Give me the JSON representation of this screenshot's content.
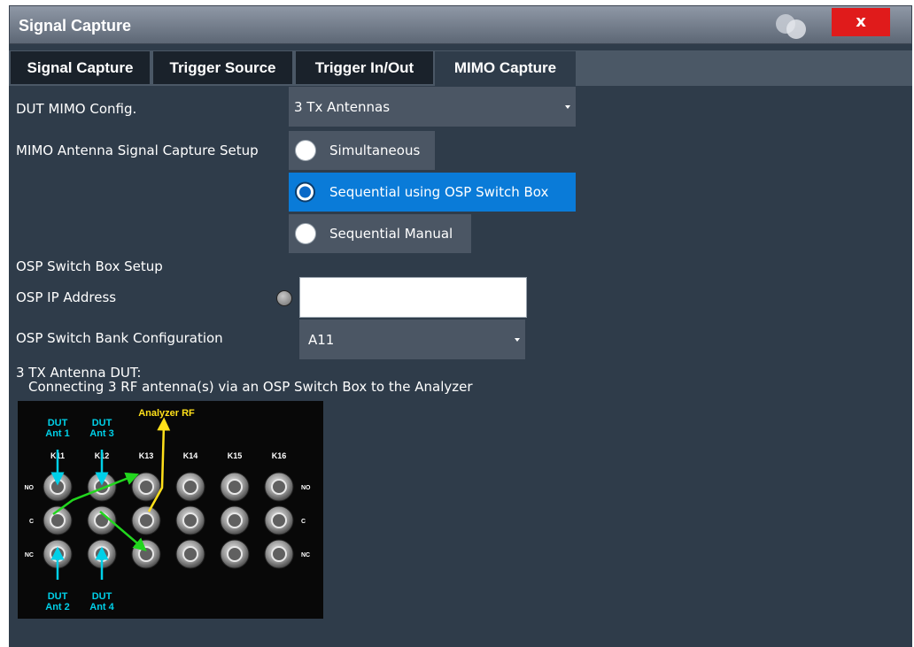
{
  "dialog": {
    "title": "Signal Capture",
    "close_label": "x"
  },
  "tabs": [
    {
      "label": "Signal Capture",
      "active": false
    },
    {
      "label": "Trigger Source",
      "active": false
    },
    {
      "label": "Trigger In/Out",
      "active": false
    },
    {
      "label": "MIMO Capture",
      "active": true
    }
  ],
  "mimo_config": {
    "label": "DUT MIMO Config.",
    "value": "3 Tx Antennas"
  },
  "capture_setup": {
    "label": "MIMO Antenna Signal Capture Setup",
    "options": [
      {
        "label": "Simultaneous",
        "selected": false
      },
      {
        "label": "Sequential using OSP Switch Box",
        "selected": true
      },
      {
        "label": "Sequential Manual",
        "selected": false
      }
    ]
  },
  "osp_setup": {
    "section_label": "OSP Switch Box Setup",
    "ip_label": "OSP IP Address",
    "ip_value": "",
    "bank_label": "OSP Switch Bank Configuration",
    "bank_value": "A11"
  },
  "dut_info": {
    "line1": "3 TX Antenna DUT:",
    "line2": "Connecting 3 RF antenna(s) via an OSP Switch Box to the Analyzer"
  },
  "diagram": {
    "analyzer_label": "Analyzer RF",
    "top_labels": [
      [
        "DUT",
        "Ant 1"
      ],
      [
        "DUT",
        "Ant 3"
      ]
    ],
    "bottom_labels": [
      [
        "DUT",
        "Ant 2"
      ],
      [
        "DUT",
        "Ant 4"
      ]
    ],
    "columns": [
      "K11",
      "K12",
      "K13",
      "K14",
      "K15",
      "K16"
    ],
    "row_labels": [
      "NO",
      "C",
      "NC"
    ]
  },
  "colors": {
    "accent": "#0a7bd8",
    "close": "#e01b1b",
    "analyzer_arrow": "#ffe01a",
    "dut_arrow": "#00d0e8",
    "path": "#22d61e"
  }
}
